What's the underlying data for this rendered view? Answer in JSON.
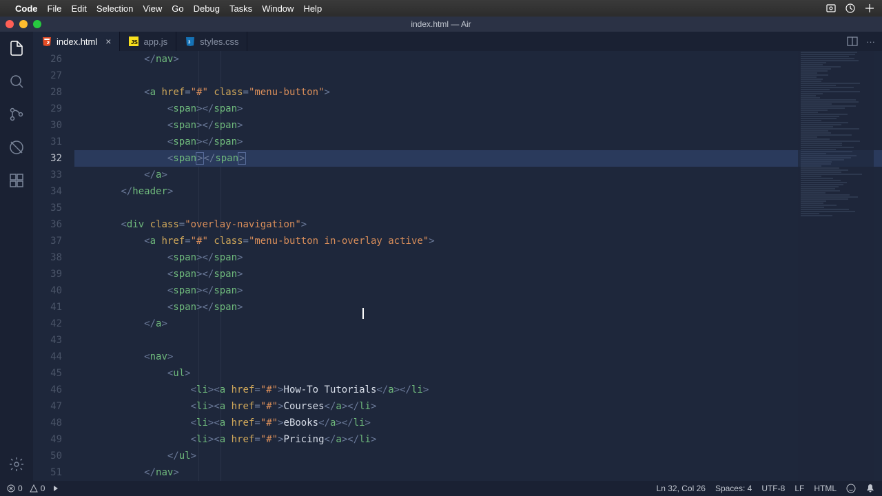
{
  "mac_menu": {
    "app": "Code",
    "items": [
      "File",
      "Edit",
      "Selection",
      "View",
      "Go",
      "Debug",
      "Tasks",
      "Window",
      "Help"
    ]
  },
  "window_title": "index.html — Air",
  "tabs": [
    {
      "label": "index.html",
      "icon": "html5-icon",
      "active": true,
      "dirty": true
    },
    {
      "label": "app.js",
      "icon": "js-icon",
      "active": false,
      "dirty": false
    },
    {
      "label": "styles.css",
      "icon": "css-icon",
      "active": false,
      "dirty": false
    }
  ],
  "line_start": 26,
  "line_end": 51,
  "active_line": 32,
  "code_lines": [
    {
      "n": 26,
      "indent": 3,
      "t": "close_tag",
      "tag": "nav"
    },
    {
      "n": 27,
      "indent": 0,
      "t": "blank"
    },
    {
      "n": 28,
      "indent": 3,
      "t": "open_a",
      "href": "#",
      "class": "menu-button"
    },
    {
      "n": 29,
      "indent": 4,
      "t": "span_pair"
    },
    {
      "n": 30,
      "indent": 4,
      "t": "span_pair"
    },
    {
      "n": 31,
      "indent": 4,
      "t": "span_pair"
    },
    {
      "n": 32,
      "indent": 4,
      "t": "span_pair_hl"
    },
    {
      "n": 33,
      "indent": 3,
      "t": "close_tag",
      "tag": "a"
    },
    {
      "n": 34,
      "indent": 2,
      "t": "close_tag",
      "tag": "header"
    },
    {
      "n": 35,
      "indent": 0,
      "t": "blank"
    },
    {
      "n": 36,
      "indent": 2,
      "t": "open_div",
      "class": "overlay-navigation"
    },
    {
      "n": 37,
      "indent": 3,
      "t": "open_a",
      "href": "#",
      "class": "menu-button in-overlay active"
    },
    {
      "n": 38,
      "indent": 4,
      "t": "span_pair"
    },
    {
      "n": 39,
      "indent": 4,
      "t": "span_pair"
    },
    {
      "n": 40,
      "indent": 4,
      "t": "span_pair"
    },
    {
      "n": 41,
      "indent": 4,
      "t": "span_pair"
    },
    {
      "n": 42,
      "indent": 3,
      "t": "close_tag",
      "tag": "a"
    },
    {
      "n": 43,
      "indent": 0,
      "t": "blank"
    },
    {
      "n": 44,
      "indent": 3,
      "t": "open_tag",
      "tag": "nav"
    },
    {
      "n": 45,
      "indent": 4,
      "t": "open_tag",
      "tag": "ul"
    },
    {
      "n": 46,
      "indent": 5,
      "t": "li_a",
      "href": "#",
      "text": "How-To Tutorials"
    },
    {
      "n": 47,
      "indent": 5,
      "t": "li_a",
      "href": "#",
      "text": "Courses"
    },
    {
      "n": 48,
      "indent": 5,
      "t": "li_a",
      "href": "#",
      "text": "eBooks"
    },
    {
      "n": 49,
      "indent": 5,
      "t": "li_a",
      "href": "#",
      "text": "Pricing"
    },
    {
      "n": 50,
      "indent": 4,
      "t": "close_tag",
      "tag": "ul"
    },
    {
      "n": 51,
      "indent": 3,
      "t": "close_tag",
      "tag": "nav"
    }
  ],
  "status": {
    "errors": "0",
    "warnings": "0",
    "cursor": "Ln 32, Col 26",
    "spaces": "Spaces: 4",
    "encoding": "UTF-8",
    "eol": "LF",
    "language": "HTML"
  },
  "colors": {
    "bg": "#1e273b",
    "tag": "#6fb97c",
    "attr": "#d0a85a",
    "str": "#d98e5a",
    "punct": "#6b7a99"
  }
}
